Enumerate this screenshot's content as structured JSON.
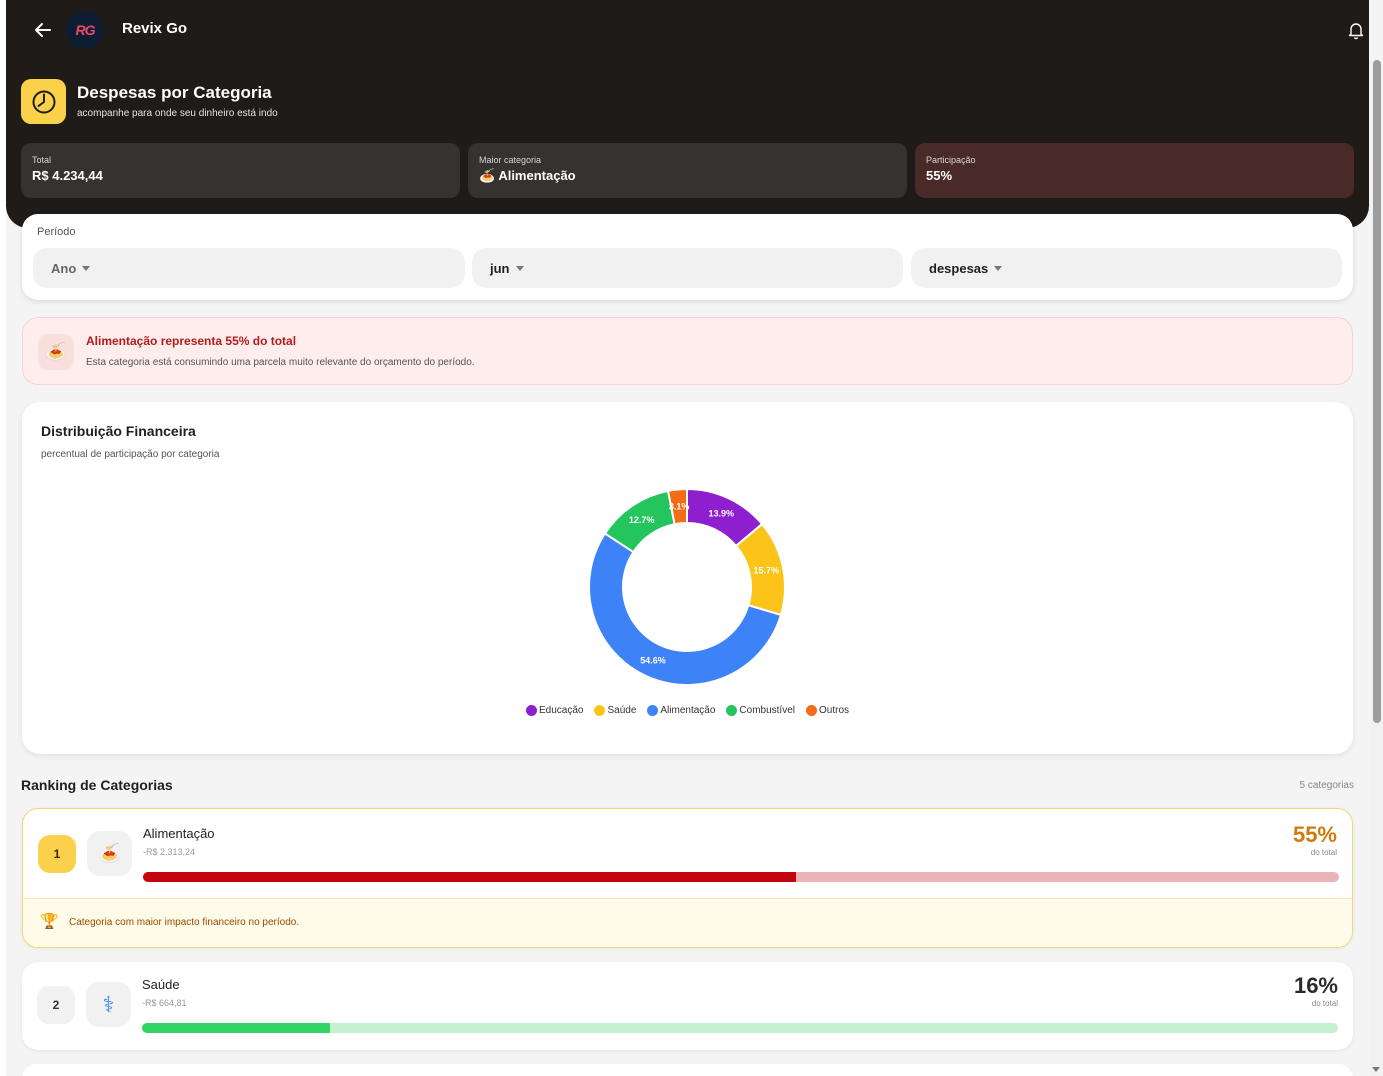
{
  "app": {
    "name": "Revix Go",
    "logo_text": "RG"
  },
  "header": {
    "title": "Despesas por Categoria",
    "subtitle": "acompanhe para onde seu dinheiro está indo",
    "stats": [
      {
        "label": "Total",
        "value": "R$ 4.234,44"
      },
      {
        "label": "Maior categoria",
        "value": "🍝 Alimentação"
      },
      {
        "label": "Participação",
        "value": "55%"
      }
    ]
  },
  "period": {
    "label": "Período",
    "year": "Ano",
    "month": "jun",
    "type": "despesas"
  },
  "alert": {
    "icon": "🍝",
    "title": "Alimentação representa 55% do total",
    "text": "Esta categoria está consumindo uma parcela muito relevante do orçamento do período."
  },
  "chart_card": {
    "title": "Distribuição Financeira",
    "subtitle": "percentual de participação por categoria"
  },
  "chart_data": {
    "type": "pie",
    "donut": true,
    "categories": [
      "Educação",
      "Saúde",
      "Alimentação",
      "Combustível",
      "Outros"
    ],
    "values": [
      13.9,
      15.7,
      54.6,
      12.7,
      3.1
    ],
    "labels": [
      "13.9%",
      "15.7%",
      "54.6%",
      "12.7%",
      "3.1%"
    ],
    "colors": [
      "#8e1fcf",
      "#fcc419",
      "#3d82f6",
      "#25c55d",
      "#f46d14"
    ],
    "legend_position": "bottom"
  },
  "ranking": {
    "title": "Ranking de Categorias",
    "count": "5 categorias",
    "items": [
      {
        "rank": "1",
        "icon": "🍝",
        "name": "Alimentação",
        "amount": "-R$ 2.313,24",
        "percent": "55%",
        "percent_sub": "do total",
        "share": 0.546,
        "bar_color": "#c4040f",
        "track_color": "#ebb4b7",
        "pct_color": "#d07a0b",
        "footer_icon": "🏆",
        "footer_text": "Categoria com maior impacto financeiro no período."
      },
      {
        "rank": "2",
        "icon": "⚕",
        "name": "Saúde",
        "amount": "-R$ 664,81",
        "percent": "16%",
        "percent_sub": "do total",
        "share": 0.157,
        "bar_color": "#2fd465",
        "track_color": "#c6f1d1",
        "pct_color": "#2b2b2b"
      }
    ]
  }
}
